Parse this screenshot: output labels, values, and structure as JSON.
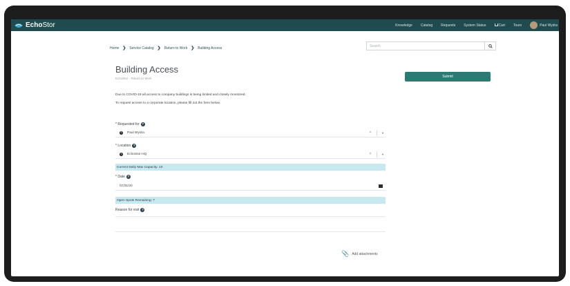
{
  "app": {
    "brand_bold": "Echo",
    "brand_thin": "Stor"
  },
  "nav": {
    "knowledge": "Knowledge",
    "catalog": "Catalog",
    "requests": "Requests",
    "system_status": "System Status",
    "cart": "Cart",
    "tours": "Tours",
    "user_name": "Paul Wydra"
  },
  "breadcrumb": {
    "home": "Home",
    "service_catalog": "Service Catalog",
    "return_to_work": "Return to Work",
    "building_access": "Building Access",
    "separator": "❯"
  },
  "search": {
    "placeholder": "Search",
    "icon": "search-icon"
  },
  "page": {
    "title": "Building Access",
    "subtitle": "EchoStor - Return to Work"
  },
  "submit_label": "Submit",
  "description": {
    "line1": "Due to COVID-19 all access to company buildings is being limited and closely monitored.",
    "line2": "To request access to a corporate location, please fill out the form below."
  },
  "form": {
    "requested_for": {
      "label": "* Requested for",
      "value": "Paul Wydra"
    },
    "location": {
      "label": "* Location",
      "value": "EchoStor HQ"
    },
    "capacity_banner": "Current Daily Max Capacity: 10",
    "date": {
      "label": "* Date",
      "value": "07/31/20"
    },
    "spots_banner": "Open Spots Remaining: 7",
    "reason": {
      "label": "Reason for visit"
    },
    "clear_symbol": "×",
    "caret_symbol": "▼",
    "help_symbol": "?",
    "info_symbol": "i"
  },
  "attachments": {
    "label": "Add attachments"
  }
}
